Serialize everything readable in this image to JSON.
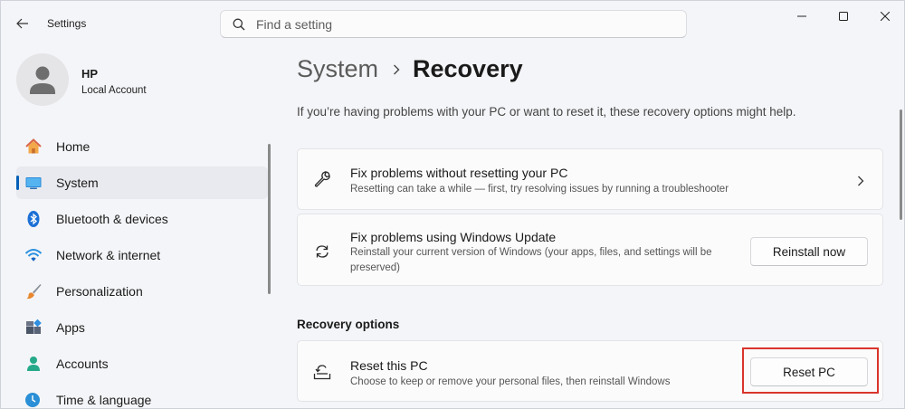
{
  "app": {
    "title": "Settings"
  },
  "search": {
    "placeholder": "Find a setting"
  },
  "profile": {
    "name": "HP",
    "account_type": "Local Account"
  },
  "sidebar": {
    "items": [
      {
        "label": "Home",
        "icon": "home-icon",
        "active": false
      },
      {
        "label": "System",
        "icon": "system-icon",
        "active": true
      },
      {
        "label": "Bluetooth & devices",
        "icon": "bluetooth-icon",
        "active": false
      },
      {
        "label": "Network & internet",
        "icon": "wifi-icon",
        "active": false
      },
      {
        "label": "Personalization",
        "icon": "brush-icon",
        "active": false
      },
      {
        "label": "Apps",
        "icon": "apps-icon",
        "active": false
      },
      {
        "label": "Accounts",
        "icon": "accounts-icon",
        "active": false
      },
      {
        "label": "Time & language",
        "icon": "time-language-icon",
        "active": false
      }
    ]
  },
  "breadcrumb": {
    "parent": "System",
    "current": "Recovery"
  },
  "intro": "If you’re having problems with your PC or want to reset it, these recovery options might help.",
  "cards": {
    "fix_without_reset": {
      "title": "Fix problems without resetting your PC",
      "description": "Resetting can take a while — first, try resolving issues by running a troubleshooter",
      "icon": "wrench-icon"
    },
    "windows_update": {
      "title": "Fix problems using Windows Update",
      "description": "Reinstall your current version of Windows (your apps, files, and settings will be preserved)",
      "button": "Reinstall now",
      "icon": "refresh-icon"
    }
  },
  "recovery_options": {
    "heading": "Recovery options",
    "reset_pc": {
      "title": "Reset this PC",
      "description": "Choose to keep or remove your personal files, then reinstall Windows",
      "button": "Reset PC",
      "icon": "reset-pc-icon"
    }
  },
  "colors": {
    "accent": "#005fb8",
    "highlight_box": "#d9342b",
    "window_bg": "#f4f5f8"
  }
}
